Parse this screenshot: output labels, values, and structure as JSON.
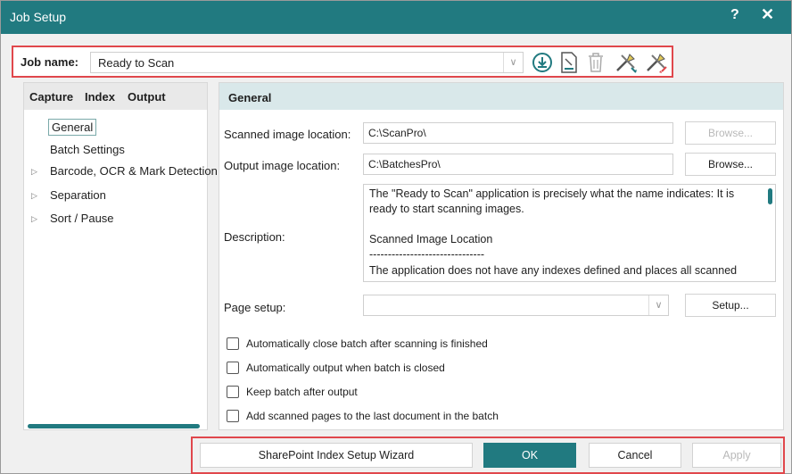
{
  "window": {
    "title": "Job Setup",
    "help": "?",
    "close": "✕"
  },
  "job": {
    "label": "Job name:",
    "value": "Ready to Scan"
  },
  "tabs": [
    "Capture",
    "Index",
    "Output"
  ],
  "tree": {
    "general": "General",
    "batch": "Batch Settings",
    "barcode": "Barcode, OCR & Mark Detection",
    "separation": "Separation",
    "sort": "Sort / Pause"
  },
  "section": {
    "title": "General"
  },
  "form": {
    "scanned_label": "Scanned image location:",
    "scanned_value": "C:\\ScanPro\\",
    "output_label": "Output image location:",
    "output_value": "C:\\BatchesPro\\",
    "browse": "Browse...",
    "description_label": "Description:",
    "description_lines": [
      "The \"Ready to Scan\" application is precisely what the name indicates: It is ready to start scanning images.",
      "Scanned Image Location",
      "-------------------------------",
      "The application does not have any indexes defined and places all scanned"
    ],
    "page_setup_label": "Page setup:",
    "page_setup_value": "",
    "setup": "Setup..."
  },
  "checkboxes": [
    "Automatically close batch after scanning is finished",
    "Automatically output when batch is closed",
    "Keep batch after output",
    "Add scanned pages to the last document in the batch"
  ],
  "footer": {
    "wizard": "SharePoint Index Setup Wizard",
    "ok": "OK",
    "cancel": "Cancel",
    "apply": "Apply"
  },
  "icons": [
    "download-icon",
    "edit-document-icon",
    "trash-icon",
    "import-tools-icon",
    "export-tools-icon"
  ],
  "colors": {
    "accent": "#217a80",
    "highlight": "#e0474c",
    "section": "#d9e8ea"
  }
}
